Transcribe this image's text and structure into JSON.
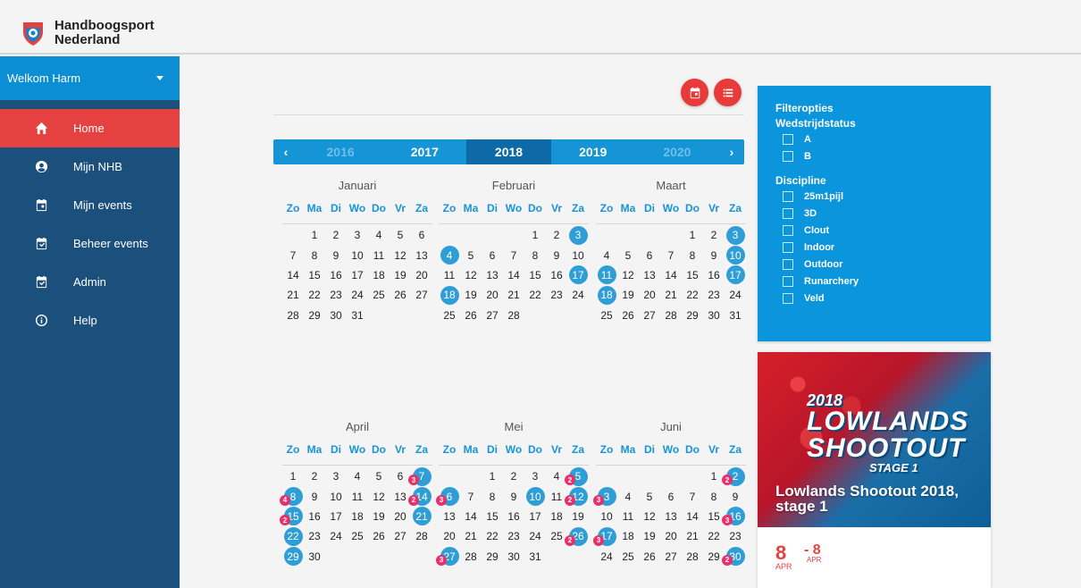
{
  "brand": {
    "line1": "Handboogsport",
    "line2": "Nederland"
  },
  "sidebar": {
    "welcome": "Welkom Harm",
    "items": [
      {
        "label": "Home",
        "icon": "home-icon",
        "active": true
      },
      {
        "label": "Mijn NHB",
        "icon": "user-icon",
        "active": false
      },
      {
        "label": "Mijn events",
        "icon": "calendar-icon",
        "active": false
      },
      {
        "label": "Beheer events",
        "icon": "calendar-check-icon",
        "active": false
      },
      {
        "label": "Admin",
        "icon": "calendar-check-icon",
        "active": false
      },
      {
        "label": "Help",
        "icon": "info-icon",
        "active": false
      }
    ]
  },
  "years": [
    {
      "label": "2016",
      "state": "faded"
    },
    {
      "label": "2017",
      "state": "normal"
    },
    {
      "label": "2018",
      "state": "active"
    },
    {
      "label": "2019",
      "state": "normal"
    },
    {
      "label": "2020",
      "state": "faded"
    }
  ],
  "weekdays": [
    "Zo",
    "Ma",
    "Di",
    "Wo",
    "Do",
    "Vr",
    "Za"
  ],
  "months": [
    {
      "name": "Januari",
      "offset": 1,
      "days": 31,
      "highlights": [],
      "badges": {}
    },
    {
      "name": "Februari",
      "offset": 4,
      "days": 28,
      "highlights": [
        3,
        4,
        17,
        18
      ],
      "badges": {}
    },
    {
      "name": "Maart",
      "offset": 4,
      "days": 31,
      "highlights": [
        3,
        10,
        11,
        17,
        18
      ],
      "badges": {}
    },
    {
      "name": "April",
      "offset": 0,
      "days": 30,
      "highlights": [
        7,
        8,
        14,
        15,
        21,
        22,
        29
      ],
      "badges": {
        "7": "3",
        "8": "4",
        "14": "2",
        "15": "2"
      }
    },
    {
      "name": "Mei",
      "offset": 2,
      "days": 31,
      "highlights": [
        5,
        6,
        10,
        12,
        26,
        27
      ],
      "badges": {
        "5": "2",
        "6": "3",
        "12": "2",
        "26": "2",
        "27": "3"
      }
    },
    {
      "name": "Juni",
      "offset": 5,
      "days": 30,
      "highlights": [
        2,
        3,
        16,
        17,
        30
      ],
      "badges": {
        "2": "2",
        "3": "3",
        "16": "3",
        "17": "3",
        "30": "2"
      }
    }
  ],
  "filter": {
    "title": "Filteropties",
    "status_label": "Wedstrijdstatus",
    "status_options": [
      "A",
      "B"
    ],
    "discipline_label": "Discipline",
    "discipline_options": [
      "25m1pijl",
      "3D",
      "Clout",
      "Indoor",
      "Outdoor",
      "Runarchery",
      "Veld"
    ]
  },
  "event": {
    "logo_year": "2018",
    "logo_line1": "LOWLANDS",
    "logo_line2": "SHOOTOUT",
    "logo_stage": "STAGE 1",
    "title": "Lowlands Shootout 2018, stage 1",
    "start_day": "8",
    "start_month": "APR",
    "end_day": "- 8",
    "end_month": "APR"
  },
  "colors": {
    "primary": "#0b95dd",
    "accent": "#e64141",
    "sidebar": "#1b4f7c",
    "badge": "#e8306a"
  }
}
